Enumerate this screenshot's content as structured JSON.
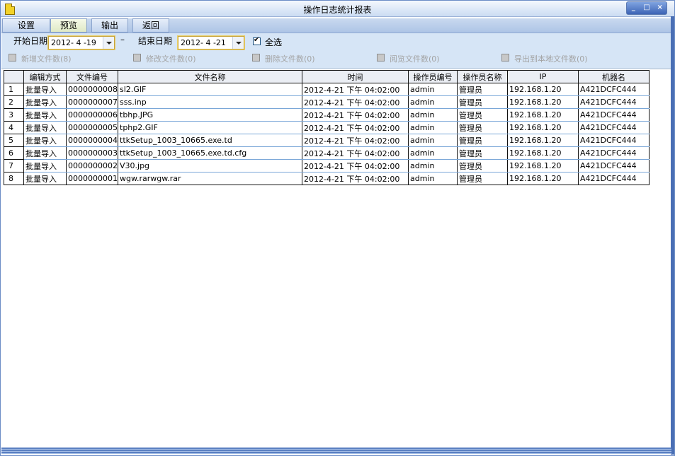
{
  "window": {
    "title": "操作日志统计报表",
    "controls": [
      "_",
      "□",
      "×"
    ]
  },
  "toolbar": {
    "items": [
      "设置",
      "预览",
      "输出",
      "返回"
    ]
  },
  "filter": {
    "start_label": "开始日期",
    "start_value": "2012- 4 -19",
    "separator": "–",
    "end_label": "结束日期",
    "end_value": "2012- 4 -21",
    "select_all_label": "全选",
    "select_all_checked": true,
    "options": [
      "新增文件数(8)",
      "修改文件数(0)",
      "删除文件数(0)",
      "阅览文件数(0)",
      "导出到本地文件数(0)"
    ]
  },
  "table": {
    "columns": [
      "",
      "编辑方式",
      "文件编号",
      "文件名称",
      "时间",
      "操作员编号",
      "操作员名称",
      "IP",
      "机器名"
    ],
    "rows": [
      [
        "1",
        "批量导入",
        "0000000008",
        "sl2.GIF",
        "2012-4-21 下午 04:02:00",
        "admin",
        "管理员",
        "192.168.1.20",
        "A421DCFC444"
      ],
      [
        "2",
        "批量导入",
        "0000000007",
        "sss.inp",
        "2012-4-21 下午 04:02:00",
        "admin",
        "管理员",
        "192.168.1.20",
        "A421DCFC444"
      ],
      [
        "3",
        "批量导入",
        "0000000006",
        "tbhp.JPG",
        "2012-4-21 下午 04:02:00",
        "admin",
        "管理员",
        "192.168.1.20",
        "A421DCFC444"
      ],
      [
        "4",
        "批量导入",
        "0000000005",
        "tphp2.GIF",
        "2012-4-21 下午 04:02:00",
        "admin",
        "管理员",
        "192.168.1.20",
        "A421DCFC444"
      ],
      [
        "5",
        "批量导入",
        "0000000004",
        "ttkSetup_1003_10665.exe.td",
        "2012-4-21 下午 04:02:00",
        "admin",
        "管理员",
        "192.168.1.20",
        "A421DCFC444"
      ],
      [
        "6",
        "批量导入",
        "0000000003",
        "ttkSetup_1003_10665.exe.td.cfg",
        "2012-4-21 下午 04:02:00",
        "admin",
        "管理员",
        "192.168.1.20",
        "A421DCFC444"
      ],
      [
        "7",
        "批量导入",
        "0000000002",
        "V30.jpg",
        "2012-4-21 下午 04:02:00",
        "admin",
        "管理员",
        "192.168.1.20",
        "A421DCFC444"
      ],
      [
        "8",
        "批量导入",
        "0000000001",
        "wgw.rarwgw.rar",
        "2012-4-21 下午 04:02:00",
        "admin",
        "管理员",
        "192.168.1.20",
        "A421DCFC444"
      ]
    ]
  }
}
